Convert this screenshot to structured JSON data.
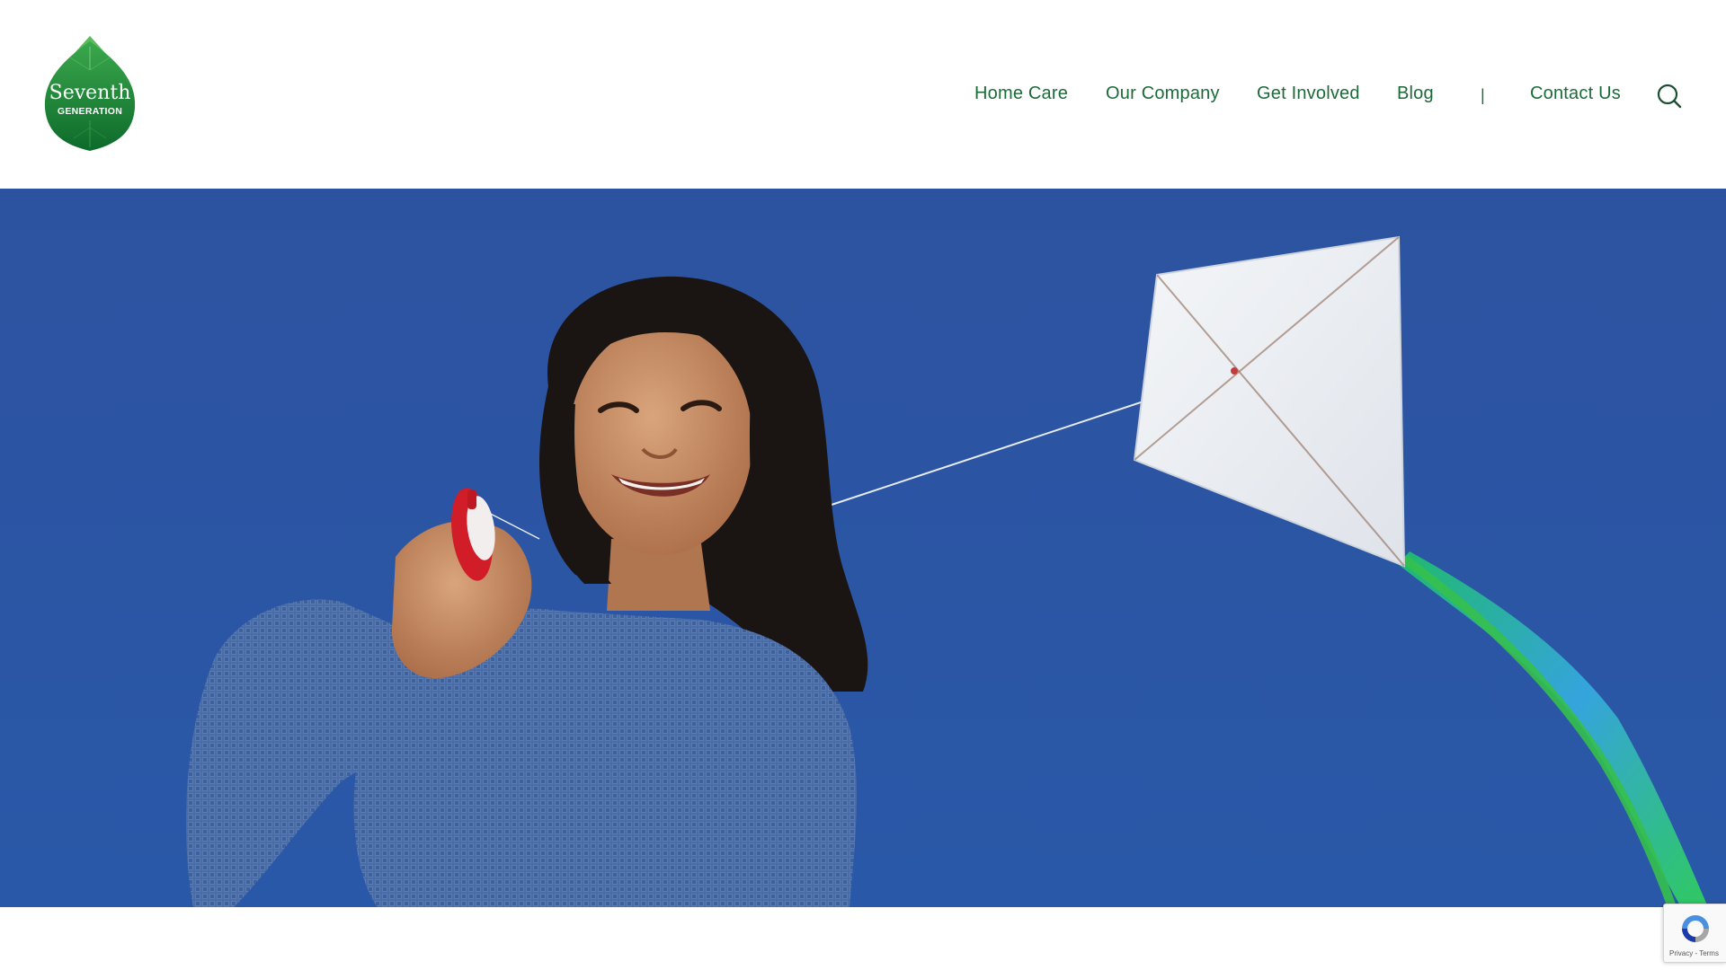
{
  "brand": {
    "logo_line1": "Seventh",
    "logo_line2": "GENERATION",
    "leaf_color": "#1e8f3e",
    "leaf_dark": "#0f6b2c"
  },
  "nav": {
    "items": [
      {
        "label": "Home Care"
      },
      {
        "label": "Our Company"
      },
      {
        "label": "Get Involved"
      },
      {
        "label": "Blog"
      },
      {
        "label": "Contact Us"
      }
    ],
    "separator": "|",
    "text_color": "#1b6b38"
  },
  "search": {
    "icon": "search-icon"
  },
  "hero": {
    "image_alt": "Smiling girl flying a white kite against a blue sky",
    "sky_color": "#2b55a2"
  },
  "recaptcha": {
    "terms": "Privacy - Terms"
  }
}
